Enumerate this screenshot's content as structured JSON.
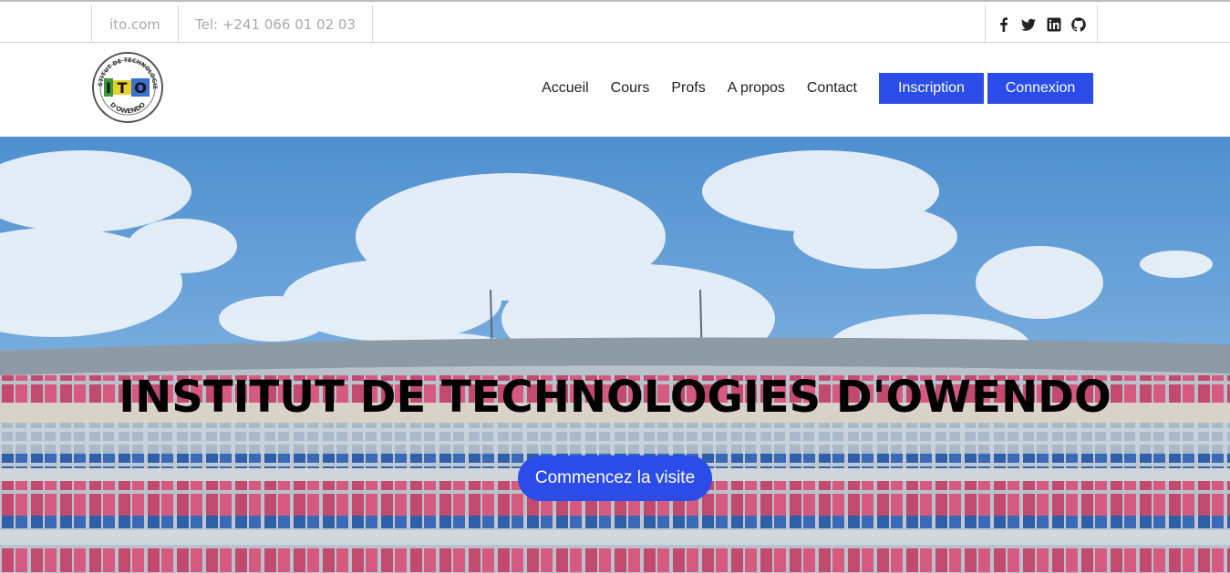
{
  "topbar": {
    "domain": "ito.com",
    "phone": "Tel: +241 066 01 02 03",
    "socials": [
      "facebook-icon",
      "twitter-icon",
      "linkedin-icon",
      "github-icon"
    ]
  },
  "logo": {
    "alt": "ITO logo",
    "text_top": "INSTITUT DE TECHNOLOGIES",
    "text_bottom": "D'OWENDO",
    "mark": "ITO"
  },
  "nav": {
    "links": [
      "Accueil",
      "Cours",
      "Profs",
      "A propos",
      "Contact"
    ],
    "inscription": "Inscription",
    "connexion": "Connexion"
  },
  "hero": {
    "title": "INSTITUT DE TECHNOLOGIES D'OWENDO",
    "cta": "Commencez la visite"
  },
  "colors": {
    "accent": "#2b4ce8",
    "sky": "#5b95cf",
    "building_red": "#c14a6e",
    "building_blue": "#2f5fa8"
  }
}
